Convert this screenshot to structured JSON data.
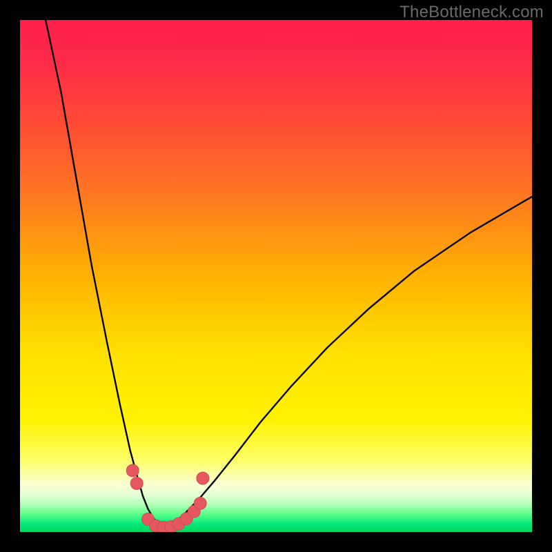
{
  "watermark": "TheBottleneck.com",
  "colors": {
    "frame": "#000000",
    "gradient_stops": [
      {
        "offset": 0.0,
        "color": "#ff1f4c"
      },
      {
        "offset": 0.08,
        "color": "#ff2a48"
      },
      {
        "offset": 0.2,
        "color": "#ff4a34"
      },
      {
        "offset": 0.35,
        "color": "#ff7a20"
      },
      {
        "offset": 0.5,
        "color": "#ffb200"
      },
      {
        "offset": 0.65,
        "color": "#ffe000"
      },
      {
        "offset": 0.78,
        "color": "#fff200"
      },
      {
        "offset": 0.86,
        "color": "#fcff66"
      },
      {
        "offset": 0.905,
        "color": "#fbffd0"
      },
      {
        "offset": 0.925,
        "color": "#e8ffd8"
      },
      {
        "offset": 0.945,
        "color": "#b9ffba"
      },
      {
        "offset": 0.965,
        "color": "#5dff8a"
      },
      {
        "offset": 0.985,
        "color": "#00e878"
      },
      {
        "offset": 1.0,
        "color": "#00d860"
      }
    ],
    "curve_stroke": "#000000",
    "marker_fill": "#e65760",
    "marker_stroke": "#d14a53"
  },
  "chart_data": {
    "type": "line",
    "title": "",
    "xlabel": "",
    "ylabel": "",
    "x_range": [
      0,
      100
    ],
    "y_range": [
      0,
      100
    ],
    "grid": false,
    "note": "Bottleneck-style V-curve. Values estimated from pixel positions; axes are unlabeled so units are relative 0–100. y≈100 at top, y≈0 at bottom (green zone). Minimum ≈ x 28.",
    "series": [
      {
        "name": "left-branch",
        "x": [
          5.0,
          8.0,
          11.0,
          14.0,
          17.0,
          19.5,
          21.5,
          23.0,
          24.0,
          25.0,
          26.0,
          27.0,
          28.0
        ],
        "values": [
          100.0,
          86.0,
          69.0,
          52.0,
          37.0,
          25.0,
          16.0,
          10.5,
          7.0,
          4.5,
          2.8,
          1.5,
          0.8
        ]
      },
      {
        "name": "right-branch",
        "x": [
          28.0,
          30.0,
          32.0,
          35.0,
          38.0,
          42.0,
          47.0,
          53.0,
          60.0,
          68.0,
          77.0,
          88.0,
          100.0
        ],
        "values": [
          0.8,
          1.7,
          3.4,
          6.5,
          10.0,
          15.0,
          21.5,
          28.5,
          36.0,
          43.5,
          51.0,
          58.5,
          65.5
        ]
      }
    ],
    "markers": {
      "name": "highlighted-points",
      "note": "Pink dots along the bottom of the V, approximate.",
      "points": [
        {
          "x": 22.0,
          "y": 12.0
        },
        {
          "x": 22.8,
          "y": 9.5
        },
        {
          "x": 25.0,
          "y": 2.5
        },
        {
          "x": 26.5,
          "y": 1.2
        },
        {
          "x": 28.0,
          "y": 0.9
        },
        {
          "x": 29.5,
          "y": 1.0
        },
        {
          "x": 31.0,
          "y": 1.6
        },
        {
          "x": 32.5,
          "y": 2.6
        },
        {
          "x": 34.0,
          "y": 4.0
        },
        {
          "x": 35.2,
          "y": 5.6
        },
        {
          "x": 35.7,
          "y": 10.5
        }
      ]
    }
  }
}
